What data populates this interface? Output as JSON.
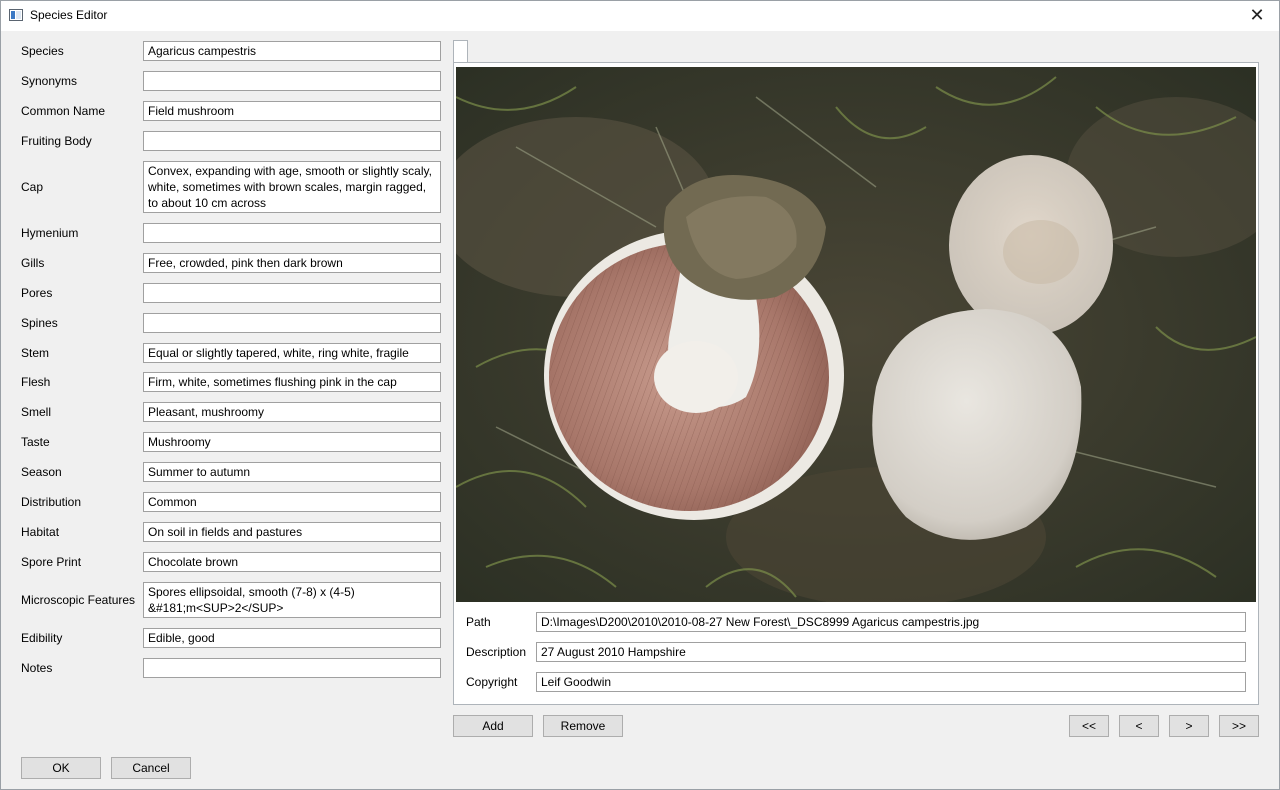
{
  "window": {
    "title": "Species Editor",
    "close_glyph": "✕"
  },
  "fields": [
    {
      "label": "Species",
      "value": "Agaricus campestris"
    },
    {
      "label": "Synonyms",
      "value": ""
    },
    {
      "label": "Common Name",
      "value": "Field mushroom"
    },
    {
      "label": "Fruiting Body",
      "value": ""
    },
    {
      "label": "Cap",
      "value": "Convex, expanding with age, smooth or slightly scaly,\nwhite, sometimes with brown scales, margin ragged,\nto about 10 cm across"
    },
    {
      "label": "Hymenium",
      "value": ""
    },
    {
      "label": "Gills",
      "value": "Free, crowded, pink then dark brown"
    },
    {
      "label": "Pores",
      "value": ""
    },
    {
      "label": "Spines",
      "value": ""
    },
    {
      "label": "Stem",
      "value": "Equal or slightly tapered, white, ring white, fragile"
    },
    {
      "label": "Flesh",
      "value": "Firm, white, sometimes flushing pink in the cap"
    },
    {
      "label": "Smell",
      "value": "Pleasant, mushroomy"
    },
    {
      "label": "Taste",
      "value": "Mushroomy"
    },
    {
      "label": "Season",
      "value": "Summer to autumn"
    },
    {
      "label": "Distribution",
      "value": "Common"
    },
    {
      "label": "Habitat",
      "value": "On soil in fields and pastures"
    },
    {
      "label": "Spore Print",
      "value": "Chocolate brown"
    },
    {
      "label": "Microscopic Features",
      "value": "Spores ellipsoidal, smooth (7-8) x (4-5)\n&#181;m<SUP>2</SUP>"
    },
    {
      "label": "Edibility",
      "value": "Edible, good"
    },
    {
      "label": "Notes",
      "value": ""
    }
  ],
  "image": {
    "path_label": "Path",
    "path_value": "D:\\Images\\D200\\2010\\2010-08-27 New Forest\\_DSC8999 Agaricus campestris.jpg",
    "description_label": "Description",
    "description_value": "27 August 2010 Hampshire",
    "copyright_label": "Copyright",
    "copyright_value": "Leif Goodwin"
  },
  "buttons": {
    "add": "Add",
    "remove": "Remove",
    "first": "<<",
    "prev": "<",
    "next": ">",
    "last": ">>",
    "ok": "OK",
    "cancel": "Cancel"
  }
}
